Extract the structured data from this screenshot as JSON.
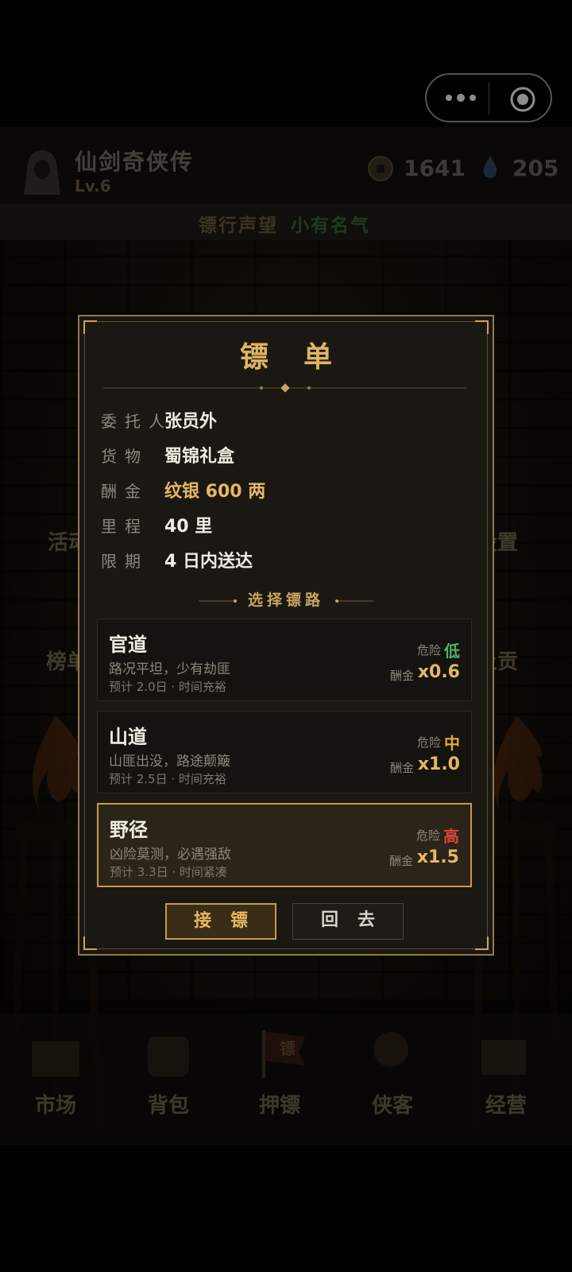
{
  "header": {
    "player_name": "仙剑奇侠传",
    "level": "Lv.6",
    "coins": "1641",
    "gems": "205",
    "reputation_label": "镖行声望",
    "reputation_value": "小有名气"
  },
  "background": {
    "left_labels": [
      "活动",
      "榜单"
    ],
    "right_labels": [
      "设置",
      "上贡"
    ],
    "bottom_nav": [
      "市场",
      "背包",
      "押镖",
      "侠客",
      "经营"
    ],
    "flag_char": "镖"
  },
  "modal": {
    "title": "镖单",
    "rows": [
      {
        "label": "委托人",
        "value": "张员外"
      },
      {
        "label": "货物",
        "value": "蜀锦礼盒"
      },
      {
        "label": "酬金",
        "value": "纹银 600 两"
      },
      {
        "label": "里程",
        "value": "40 里"
      },
      {
        "label": "限期",
        "value": "4 日内送达"
      }
    ],
    "section_title": "选择镖路",
    "routes": [
      {
        "name": "官道",
        "desc": "路况平坦，少有劫匪",
        "estimate": "预计 2.0日 · 时间充裕",
        "risk_label": "危险",
        "risk": "低",
        "risk_color": "#4fb16a",
        "pay_label": "酬金",
        "pay": "x0.6",
        "selected": false
      },
      {
        "name": "山道",
        "desc": "山匪出没，路途颠簸",
        "estimate": "预计 2.5日 · 时间充裕",
        "risk_label": "危险",
        "risk": "中",
        "risk_color": "#e0a83a",
        "pay_label": "酬金",
        "pay": "x1.0",
        "selected": false
      },
      {
        "name": "野径",
        "desc": "凶险莫测，必遇强敌",
        "estimate": "预计 3.3日 · 时间紧凑",
        "risk_label": "危险",
        "risk": "高",
        "risk_color": "#d9473c",
        "pay_label": "酬金",
        "pay": "x1.5",
        "selected": true
      }
    ],
    "accept_label": "接镖",
    "back_label": "回去"
  },
  "colors": {
    "gold": "#e3b764",
    "accent_border": "#c79a45",
    "panel_bg": "#1b1814"
  }
}
